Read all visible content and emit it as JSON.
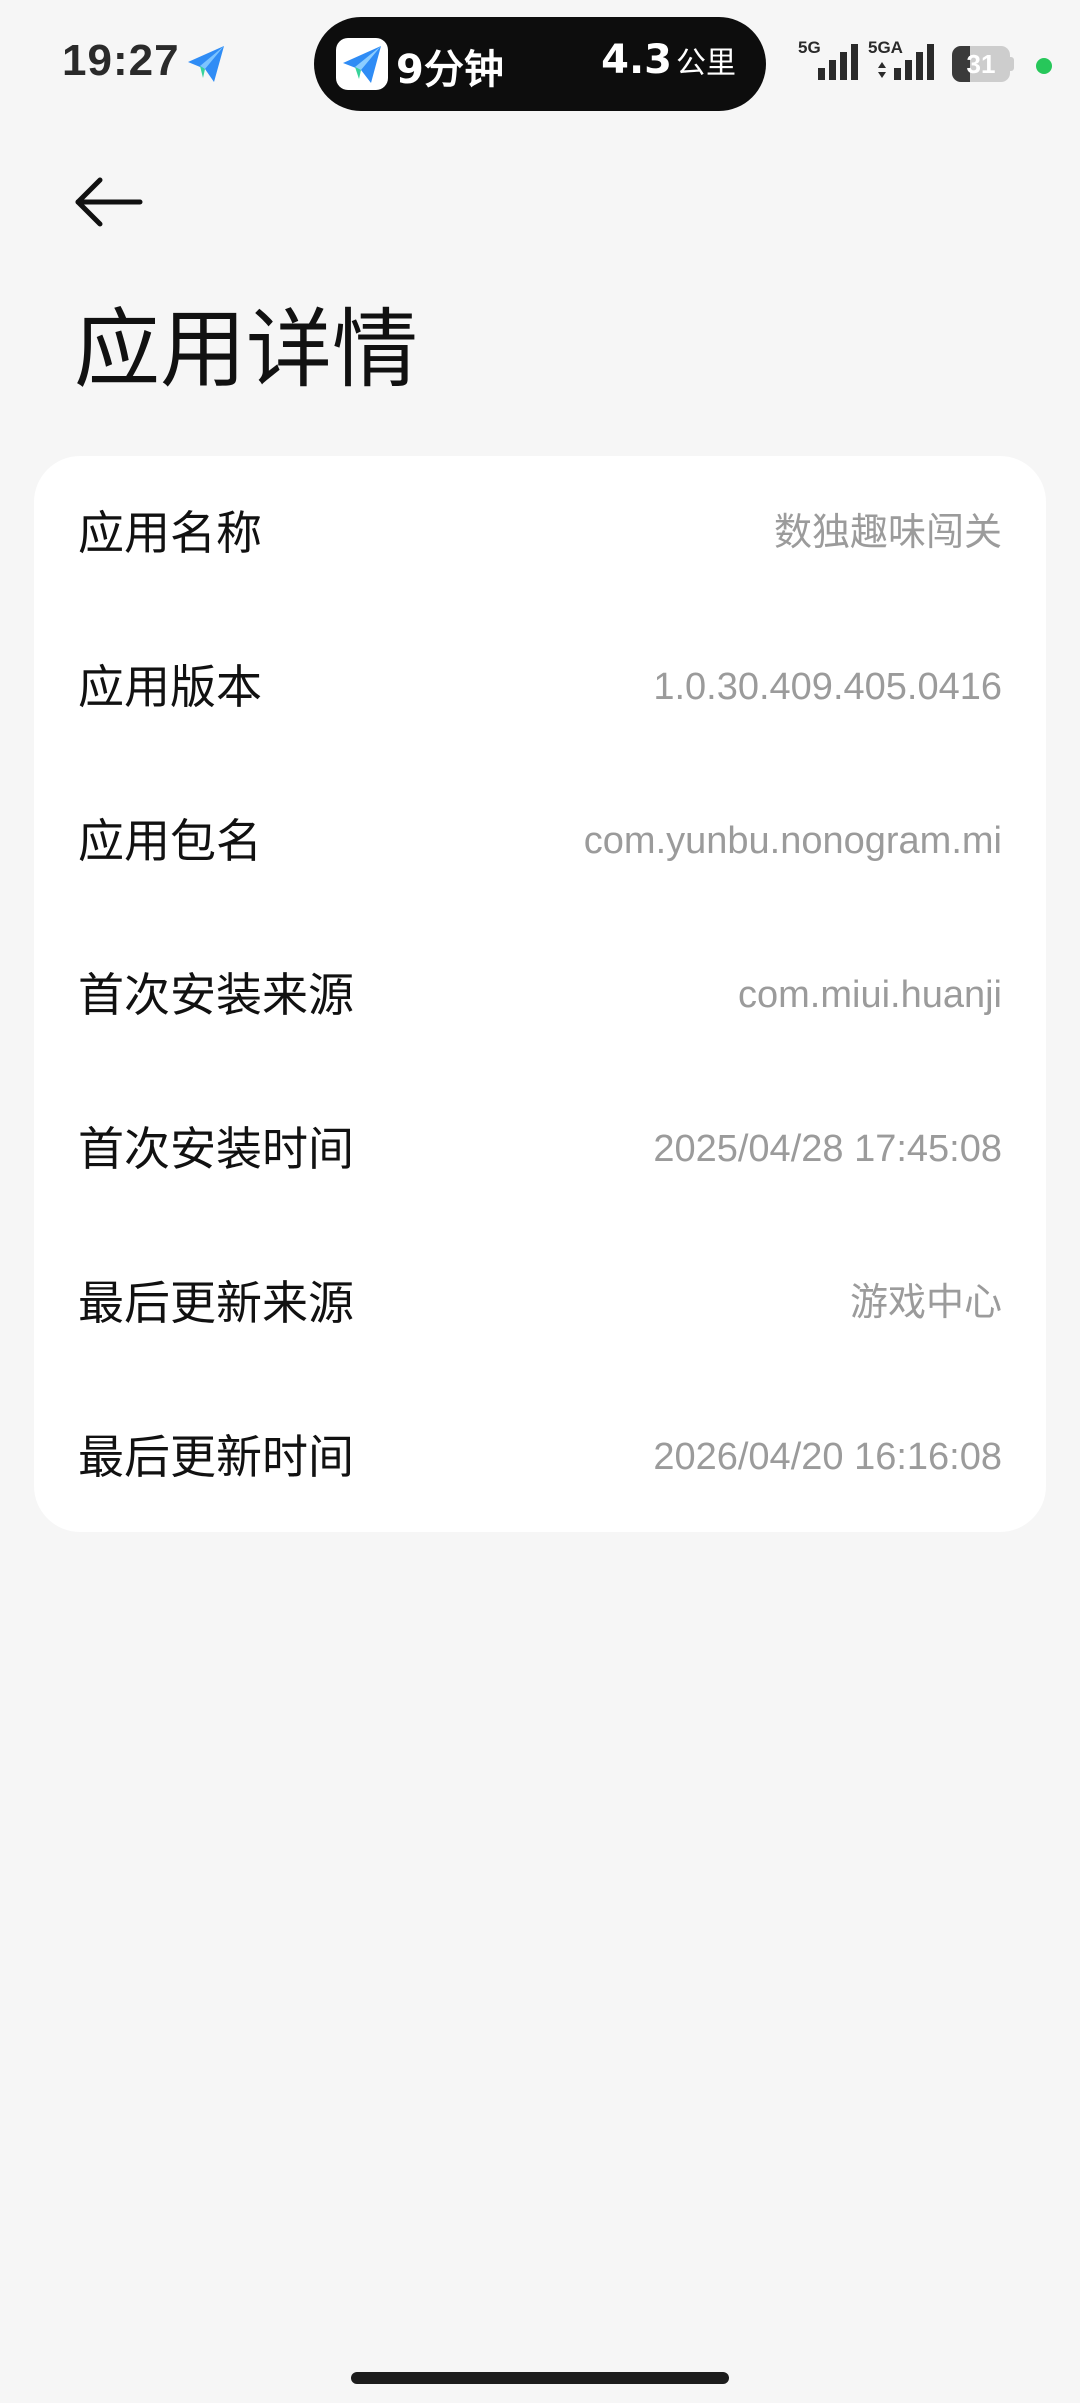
{
  "status_bar": {
    "time": "19:27",
    "app_icon": "paper-plane-icon",
    "activity_pill": {
      "icon": "paper-plane-icon",
      "duration": "9分钟",
      "distance_value": "4.3",
      "distance_unit": "公里"
    },
    "signal_1": {
      "label": "5G",
      "bars": 4
    },
    "signal_2": {
      "label": "5GA",
      "bars": 4
    },
    "battery_level": "31",
    "battery_fraction": 0.31,
    "indicator_color": "#27c75a"
  },
  "header": {
    "back_icon": "arrow-left-icon",
    "title": "应用详情"
  },
  "details": [
    {
      "label": "应用名称",
      "value": "数独趣味闯关"
    },
    {
      "label": "应用版本",
      "value": "1.0.30.409.405.0416"
    },
    {
      "label": "应用包名",
      "value": "com.yunbu.nonogram.mi"
    },
    {
      "label": "首次安装来源",
      "value": "com.miui.huanji"
    },
    {
      "label": "首次安装时间",
      "value": "2025/04/28 17:45:08"
    },
    {
      "label": "最后更新来源",
      "value": "游戏中心"
    },
    {
      "label": "最后更新时间",
      "value": "2026/04/20 16:16:08"
    }
  ]
}
